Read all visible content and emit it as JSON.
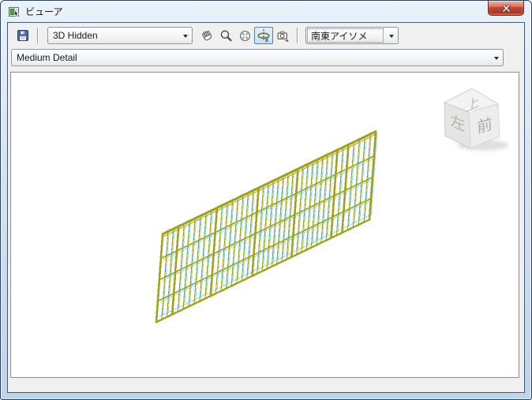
{
  "window": {
    "title": "ビューア"
  },
  "toolbar": {
    "visual_style_combo": {
      "value": "3D Hidden"
    },
    "view_combo": {
      "value": "南東アイソメ",
      "focused": true
    },
    "buttons": [
      {
        "name": "save",
        "icon": "floppy-disk-icon",
        "pressed": false
      },
      {
        "name": "pan",
        "icon": "hand-icon",
        "pressed": false
      },
      {
        "name": "zoom",
        "icon": "magnifier-icon",
        "pressed": false
      },
      {
        "name": "orbit",
        "icon": "orbit-sphere-icon",
        "pressed": false
      },
      {
        "name": "constrained-orbit",
        "icon": "constrained-orbit-icon",
        "pressed": true
      },
      {
        "name": "adjust-camera",
        "icon": "camera-icon",
        "pressed": false
      }
    ]
  },
  "detail_combo": {
    "value": "Medium Detail"
  },
  "viewport": {
    "viewcube": {
      "top": "上",
      "left": "左",
      "front": "前"
    },
    "model": {
      "type": "railing-panels-isometric",
      "frame_color": "#a2a21c",
      "glass_color": "#8adcee"
    }
  },
  "colors": {
    "title_bar": "#d9e7f6",
    "client_bg": "#f0f0f0",
    "viewport_bg": "#ffffff",
    "close_button": "#c14936"
  }
}
